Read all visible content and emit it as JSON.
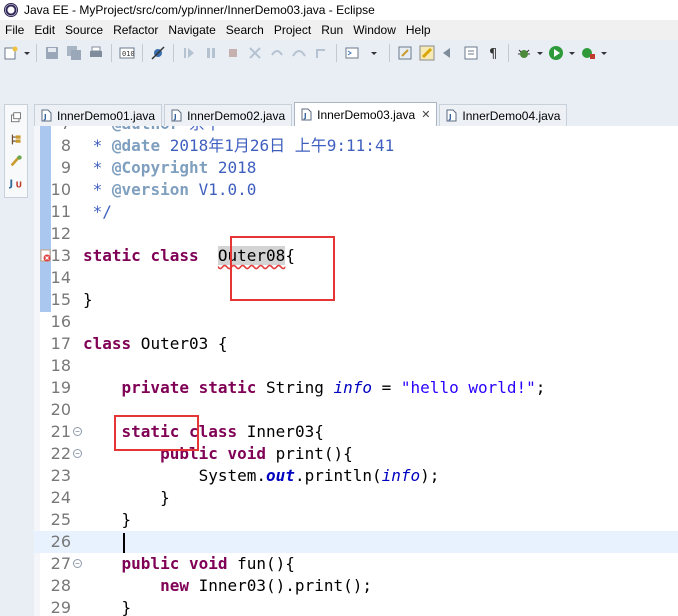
{
  "window": {
    "title": "Java EE - MyProject/src/com/yp/inner/InnerDemo03.java - Eclipse",
    "icon": "eclipse-icon"
  },
  "menu": [
    "File",
    "Edit",
    "Source",
    "Refactor",
    "Navigate",
    "Search",
    "Project",
    "Run",
    "Window",
    "Help"
  ],
  "tabs": [
    {
      "label": "InnerDemo01.java",
      "active": false
    },
    {
      "label": "InnerDemo02.java",
      "active": false
    },
    {
      "label": "InnerDemo03.java",
      "active": true,
      "close": "✕"
    },
    {
      "label": "InnerDemo04.java",
      "active": false
    }
  ],
  "editor": {
    "lines": [
      {
        "n": "7",
        "segs": [
          {
            "t": " * ",
            "c": "cmt"
          },
          {
            "t": "@author",
            "c": "tag"
          },
          {
            "t": " 余平",
            "c": "cmt"
          }
        ]
      },
      {
        "n": "8",
        "segs": [
          {
            "t": " * ",
            "c": "cmt"
          },
          {
            "t": "@date",
            "c": "tag"
          },
          {
            "t": " 2018年1月26日 上午9:11:41",
            "c": "cmt"
          }
        ]
      },
      {
        "n": "9",
        "segs": [
          {
            "t": " * ",
            "c": "cmt"
          },
          {
            "t": "@Copyright",
            "c": "tag"
          },
          {
            "t": " 2018",
            "c": "cmt"
          }
        ]
      },
      {
        "n": "10",
        "segs": [
          {
            "t": " * ",
            "c": "cmt"
          },
          {
            "t": "@version",
            "c": "tag"
          },
          {
            "t": " V1.0.0",
            "c": "cmt"
          }
        ]
      },
      {
        "n": "11",
        "segs": [
          {
            "t": " */",
            "c": "cmt"
          }
        ]
      },
      {
        "n": "12",
        "segs": []
      },
      {
        "n": "13",
        "segs": [
          {
            "t": "static",
            "c": "k"
          },
          {
            "t": " "
          },
          {
            "t": "class",
            "c": "k"
          },
          {
            "t": "  "
          },
          {
            "t": "Outer08",
            "c": "occ"
          },
          {
            "t": "{"
          }
        ],
        "error": true
      },
      {
        "n": "14",
        "segs": []
      },
      {
        "n": "15",
        "segs": [
          {
            "t": "}"
          }
        ]
      },
      {
        "n": "16",
        "segs": []
      },
      {
        "n": "17",
        "segs": [
          {
            "t": "class",
            "c": "k"
          },
          {
            "t": " Outer03 {"
          }
        ]
      },
      {
        "n": "18",
        "segs": []
      },
      {
        "n": "19",
        "segs": [
          {
            "t": "    "
          },
          {
            "t": "private",
            "c": "k"
          },
          {
            "t": " "
          },
          {
            "t": "static",
            "c": "k"
          },
          {
            "t": " String "
          },
          {
            "t": "info",
            "c": "fld"
          },
          {
            "t": " = "
          },
          {
            "t": "\"hello world!\"",
            "c": "str"
          },
          {
            "t": ";"
          }
        ]
      },
      {
        "n": "20",
        "segs": []
      },
      {
        "n": "21",
        "segs": [
          {
            "t": "    "
          },
          {
            "t": "static",
            "c": "k"
          },
          {
            "t": " "
          },
          {
            "t": "class",
            "c": "k"
          },
          {
            "t": " Inner03{"
          }
        ],
        "fold": true
      },
      {
        "n": "22",
        "segs": [
          {
            "t": "        "
          },
          {
            "t": "public",
            "c": "k"
          },
          {
            "t": " "
          },
          {
            "t": "void",
            "c": "k"
          },
          {
            "t": " print(){"
          }
        ],
        "fold": true
      },
      {
        "n": "23",
        "segs": [
          {
            "t": "            System."
          },
          {
            "t": "out",
            "c": "sfld"
          },
          {
            "t": ".println("
          },
          {
            "t": "info",
            "c": "fld"
          },
          {
            "t": ");"
          }
        ]
      },
      {
        "n": "24",
        "segs": [
          {
            "t": "        }"
          }
        ]
      },
      {
        "n": "25",
        "segs": [
          {
            "t": "    }"
          }
        ]
      },
      {
        "n": "26",
        "segs": [],
        "current": true
      },
      {
        "n": "27",
        "segs": [
          {
            "t": "    "
          },
          {
            "t": "public",
            "c": "k"
          },
          {
            "t": " "
          },
          {
            "t": "void",
            "c": "k"
          },
          {
            "t": " fun(){"
          }
        ],
        "fold": true
      },
      {
        "n": "28",
        "segs": [
          {
            "t": "        "
          },
          {
            "t": "new",
            "c": "k"
          },
          {
            "t": " Inner03().print();"
          }
        ]
      },
      {
        "n": "29",
        "segs": [
          {
            "t": "    }"
          }
        ]
      }
    ]
  },
  "colors": {
    "keyword": "#7f0055",
    "comment": "#3f5fbf",
    "string": "#2a00ff",
    "field": "#0000c0",
    "annotation_box": "#e53535"
  }
}
